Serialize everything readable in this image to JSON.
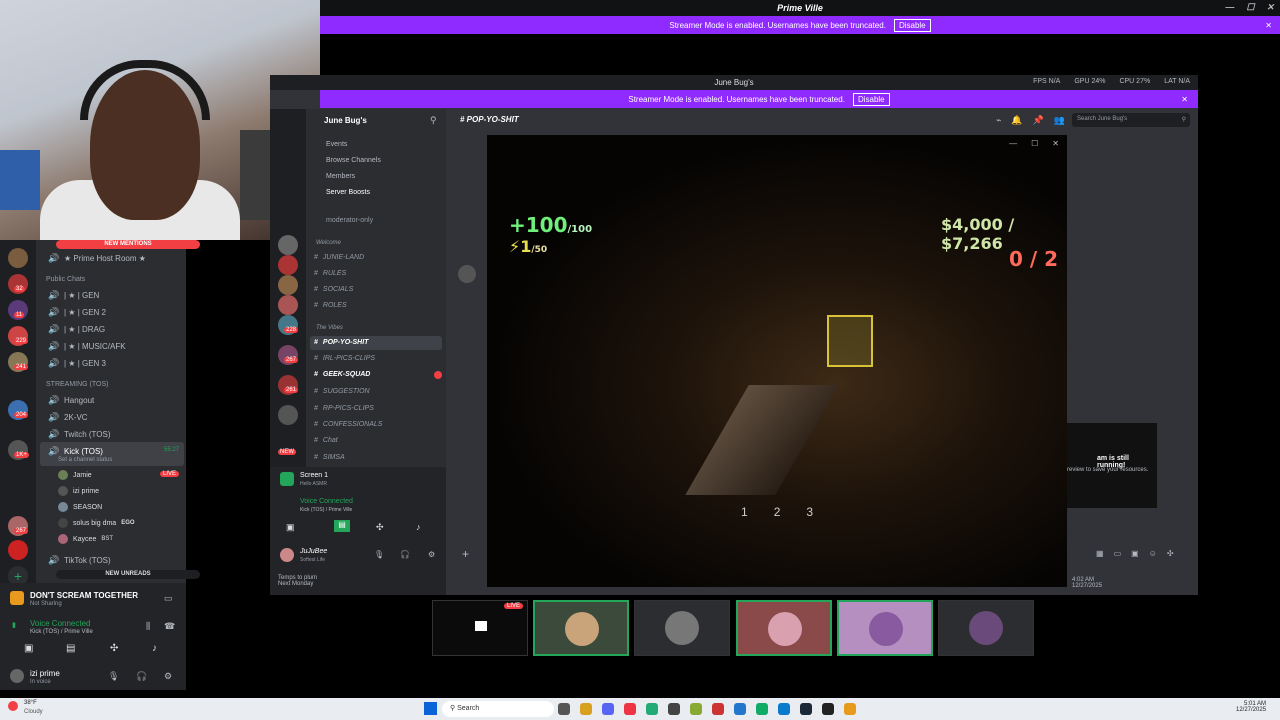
{
  "top_window": {
    "title": "Prime Ville",
    "streamer_banner": "Streamer Mode is enabled. Usernames have been truncated.",
    "disable_label": "Disable"
  },
  "second_window": {
    "title": "June Bug's",
    "streamer_banner": "Streamer Mode is enabled. Usernames have been truncated.",
    "disable_label": "Disable",
    "stats": {
      "fps": "FPS N/A",
      "gpu": "GPU 24%",
      "cpu": "CPU 27%",
      "lat": "LAT N/A"
    }
  },
  "left_sidebar": {
    "new_mentions": "NEW MENTIONS",
    "prime_host_room": "★ Prime Host Room ★",
    "public_chats": "Public Chats",
    "channels": [
      "| ★ | GEN",
      "| ★ | GEN 2",
      "| ★ | DRAG",
      "| ★ | MUSIC/AFK",
      "| ★ | GEN 3"
    ],
    "streaming_cat": "STREAMING (TOS)",
    "stream_channels": [
      "Hangout",
      "2K-VC",
      "Twitch (TOS)"
    ],
    "kick": "Kick (TOS)",
    "kick_status": "Set a channel status",
    "kick_time": "55:27",
    "kick_members": [
      {
        "name": "Jamie",
        "live": "LIVE"
      },
      {
        "name": "izi prime"
      },
      {
        "name": "SEASON"
      },
      {
        "name": "solus big dma",
        "tag": "EGO"
      },
      {
        "name": "Kaycee",
        "tag": "BST"
      }
    ],
    "tiktok": "TikTok (TOS)",
    "new_unreads": "NEW UNREADS",
    "server_card": {
      "name": "DON'T SCREAM TOGETHER",
      "sub": "Not Sharing"
    },
    "voice": {
      "label": "Voice Connected",
      "sub": "Kick (TOS) / Prime Ville"
    },
    "user": {
      "name": "izi prime",
      "status": "In voice"
    },
    "server_badges": [
      "32",
      "11",
      "229",
      "241",
      "204",
      "1K+",
      "267"
    ]
  },
  "june_server": {
    "name": "June Bug's",
    "items": [
      "Events",
      "Browse Channels",
      "Members",
      "Server Boosts"
    ],
    "moderator": "moderator-only",
    "welcome_cat": "Welcome",
    "channels_a": [
      "JUNIE-LAND",
      "RULES",
      "SOCIALS",
      "ROLES"
    ],
    "vibes_cat": "The Vibes",
    "channels_b": [
      "POP-YO-SHIT",
      "IRL-PICS-CLIPS",
      "GEEK-SQUAD",
      "SUGGESTION",
      "RP-PICS-CLIPS",
      "CONFESSIONALS",
      "Chat",
      "SIMSA"
    ],
    "screen": "Screen 1",
    "screen_sub": "Hello ASMR",
    "voice": "Voice Connected",
    "voice_sub": "Kick (TOS) / Prime Ville",
    "user": "JuJuBee",
    "user_status": "Softest Life",
    "badges": [
      "228",
      "267",
      "261",
      "NEW"
    ]
  },
  "chat_header": {
    "channel": "POP-YO-SHIT",
    "search_placeholder": "Search June Bug's"
  },
  "game": {
    "health": "+100",
    "health_max": "/100",
    "ammo": "1",
    "ammo_max": "/50",
    "money": "$4,000",
    "money_max": "$7,266",
    "score": "0 / 2",
    "slots": [
      "1",
      "2",
      "3"
    ]
  },
  "notification": {
    "title": "am is still running!",
    "body": "review to save your resources."
  },
  "footer_mini": {
    "text": "Temps to plum",
    "sub": "Next Monday"
  },
  "time": "4:02 AM",
  "date": "12/27/2025",
  "taskbar": {
    "search": "Search",
    "weather_temp": "38°F",
    "weather": "Cloudy",
    "time": "5:01 AM",
    "date": "12/27/2025"
  },
  "stream_live": "LIVE"
}
